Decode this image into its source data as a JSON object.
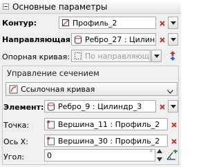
{
  "section": {
    "title": "Основные параметры"
  },
  "contour": {
    "label": "Контур:",
    "value": "Профиль_2"
  },
  "guide": {
    "label": "Направляющая:",
    "value": "Ребро_27 : Цилин"
  },
  "reference_curve": {
    "label": "Опорная кривая:",
    "value": "По направляющей"
  },
  "section_control": {
    "title": "Управление сечением",
    "type": "Ссылочная кривая",
    "element": {
      "label": "Элемент:",
      "value": "Ребро_9 : Цилиндр_3"
    },
    "point": {
      "label": "Точка:",
      "value": "Вершина_11 : Профиль_2"
    },
    "axis_x": {
      "label": "Ось X:",
      "value": "Вершина_30 : Профиль_2"
    },
    "angle": {
      "label": "Угол:",
      "value": "0",
      "unit": "°"
    }
  },
  "colors": {
    "accent_red": "#c0392b",
    "accent_blue": "#2d6bd1"
  },
  "icons": [
    "collapse-icon",
    "profile-icon",
    "edge-icon",
    "curve-icon",
    "clear-icon",
    "dropdown-icon",
    "swap-direction-icon",
    "reference-curve-icon",
    "vertex-icon",
    "angle-add-icon"
  ]
}
